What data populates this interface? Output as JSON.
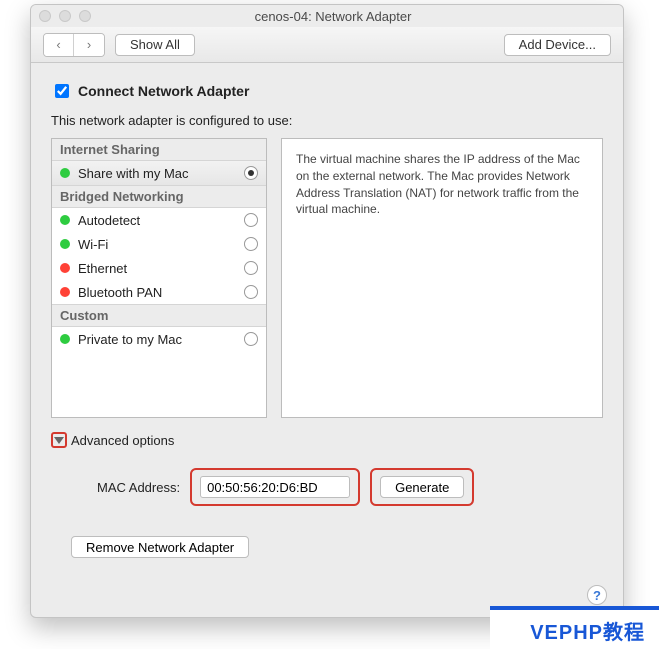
{
  "window": {
    "title": "cenos-04: Network Adapter"
  },
  "toolbar": {
    "back_icon": "‹",
    "forward_icon": "›",
    "show_all_label": "Show All",
    "add_device_label": "Add Device..."
  },
  "connect": {
    "checked": true,
    "label": "Connect Network Adapter"
  },
  "subtitle": "This network adapter is configured to use:",
  "sections": {
    "internet_sharing": {
      "header": "Internet Sharing",
      "items": [
        {
          "label": "Share with my Mac",
          "status": "green",
          "selected": true
        }
      ]
    },
    "bridged": {
      "header": "Bridged Networking",
      "items": [
        {
          "label": "Autodetect",
          "status": "green",
          "selected": false
        },
        {
          "label": "Wi-Fi",
          "status": "green",
          "selected": false
        },
        {
          "label": "Ethernet",
          "status": "red",
          "selected": false
        },
        {
          "label": "Bluetooth PAN",
          "status": "red",
          "selected": false
        }
      ]
    },
    "custom": {
      "header": "Custom",
      "items": [
        {
          "label": "Private to my Mac",
          "status": "green",
          "selected": false
        }
      ]
    }
  },
  "description": "The virtual machine shares the IP address of the Mac on the external network. The Mac provides Network Address Translation (NAT) for network traffic from the virtual machine.",
  "advanced": {
    "label": "Advanced options",
    "expanded": true
  },
  "mac": {
    "label": "MAC Address:",
    "value": "00:50:56:20:D6:BD",
    "generate_label": "Generate"
  },
  "remove_label": "Remove Network Adapter",
  "help_label": "?",
  "watermark": "VEPHP教程"
}
